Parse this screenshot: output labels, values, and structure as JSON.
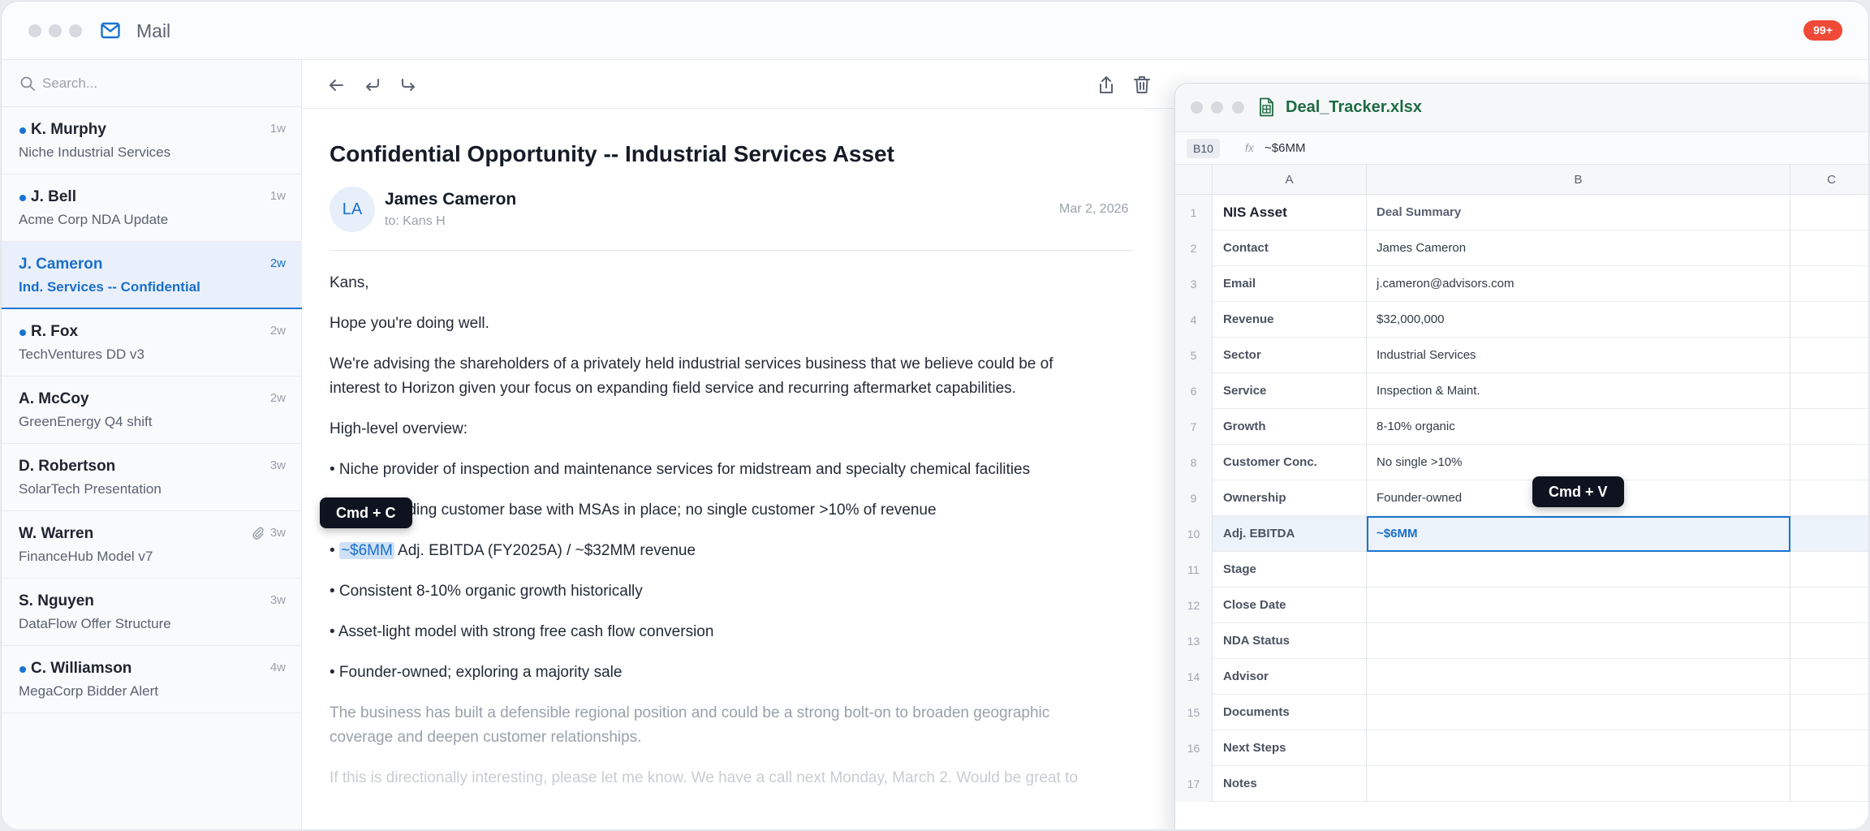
{
  "app": {
    "title": "Mail",
    "notification_count": "99+"
  },
  "search": {
    "placeholder": "Search..."
  },
  "mail_list": [
    {
      "sender": "K. Murphy",
      "subject": "Niche Industrial Services",
      "time": "1w",
      "unread": true
    },
    {
      "sender": "J. Bell",
      "subject": "Acme Corp NDA Update",
      "time": "1w",
      "unread": true
    },
    {
      "sender": "J. Cameron",
      "subject": "Ind. Services -- Confidential",
      "time": "2w",
      "selected": true
    },
    {
      "sender": "R. Fox",
      "subject": "TechVentures DD v3",
      "time": "2w",
      "unread": true
    },
    {
      "sender": "A. McCoy",
      "subject": "GreenEnergy Q4 shift",
      "time": "2w"
    },
    {
      "sender": "D. Robertson",
      "subject": "SolarTech Presentation",
      "time": "3w"
    },
    {
      "sender": "W. Warren",
      "subject": "FinanceHub Model v7",
      "time": "3w",
      "attachment": true
    },
    {
      "sender": "S. Nguyen",
      "subject": "DataFlow Offer Structure",
      "time": "3w"
    },
    {
      "sender": "C. Williamson",
      "subject": "MegaCorp Bidder Alert",
      "time": "4w",
      "unread": true
    }
  ],
  "email": {
    "subject": "Confidential Opportunity -- Industrial Services Asset",
    "avatar_initials": "LA",
    "from": "James Cameron",
    "to": "to: Kans H",
    "date": "Mar 2, 2026",
    "greeting": "Kans,",
    "line1": "Hope you're doing well.",
    "para1_a": "We're advising the shareholders of a privately held industrial services business that we believe could be of",
    "para1_b": "interest to Horizon given your focus on expanding field service and recurring aftermarket capabilities.",
    "overview_heading": "High-level overview:",
    "bullet1": "• Niche provider of inspection and maintenance services for midstream and specialty chemical facilities",
    "bullet2": "• Long-standing customer base with MSAs in place; no single customer >10% of revenue",
    "bullet3_prefix": "• ",
    "bullet3_highlight": "~$6MM",
    "bullet3_rest": " Adj. EBITDA (FY2025A) / ~$32MM revenue",
    "bullet4": "• Consistent 8-10% organic growth historically",
    "bullet5": "• Asset-light model with strong free cash flow conversion",
    "bullet6": "• Founder-owned; exploring a majority sale",
    "para2_a": "The business has built a defensible regional position and could be a strong bolt-on to broaden geographic",
    "para2_b": "coverage and deepen customer relationships.",
    "para3": "If this is directionally interesting, please let me know. We have a call next Monday, March 2. Would be great to"
  },
  "tooltips": {
    "copy": "Cmd + C",
    "paste": "Cmd + V"
  },
  "spreadsheet": {
    "file_name": "Deal_Tracker.xlsx",
    "cell_ref": "B10",
    "fx": "fx",
    "formula_value": "~$6MM",
    "columns": [
      "A",
      "B",
      "C"
    ],
    "rows": [
      {
        "n": "1",
        "a": "NIS Asset",
        "b": "Deal Summary"
      },
      {
        "n": "2",
        "a": "Contact",
        "b": "James Cameron"
      },
      {
        "n": "3",
        "a": "Email",
        "b": "j.cameron@advisors.com"
      },
      {
        "n": "4",
        "a": "Revenue",
        "b": "$32,000,000"
      },
      {
        "n": "5",
        "a": "Sector",
        "b": "Industrial Services"
      },
      {
        "n": "6",
        "a": "Service",
        "b": "Inspection & Maint."
      },
      {
        "n": "7",
        "a": "Growth",
        "b": "8-10% organic"
      },
      {
        "n": "8",
        "a": "Customer Conc.",
        "b": "No single >10%"
      },
      {
        "n": "9",
        "a": "Ownership",
        "b": "Founder-owned"
      },
      {
        "n": "10",
        "a": "Adj. EBITDA",
        "b": "~$6MM"
      },
      {
        "n": "11",
        "a": "Stage",
        "b": ""
      },
      {
        "n": "12",
        "a": "Close Date",
        "b": ""
      },
      {
        "n": "13",
        "a": "NDA Status",
        "b": ""
      },
      {
        "n": "14",
        "a": "Advisor",
        "b": ""
      },
      {
        "n": "15",
        "a": "Documents",
        "b": ""
      },
      {
        "n": "16",
        "a": "Next Steps",
        "b": ""
      },
      {
        "n": "17",
        "a": "Notes",
        "b": ""
      }
    ]
  },
  "colors": {
    "accent": "#1a73d1",
    "badge": "#ef4a38",
    "excel_green": "#1e6b43"
  }
}
